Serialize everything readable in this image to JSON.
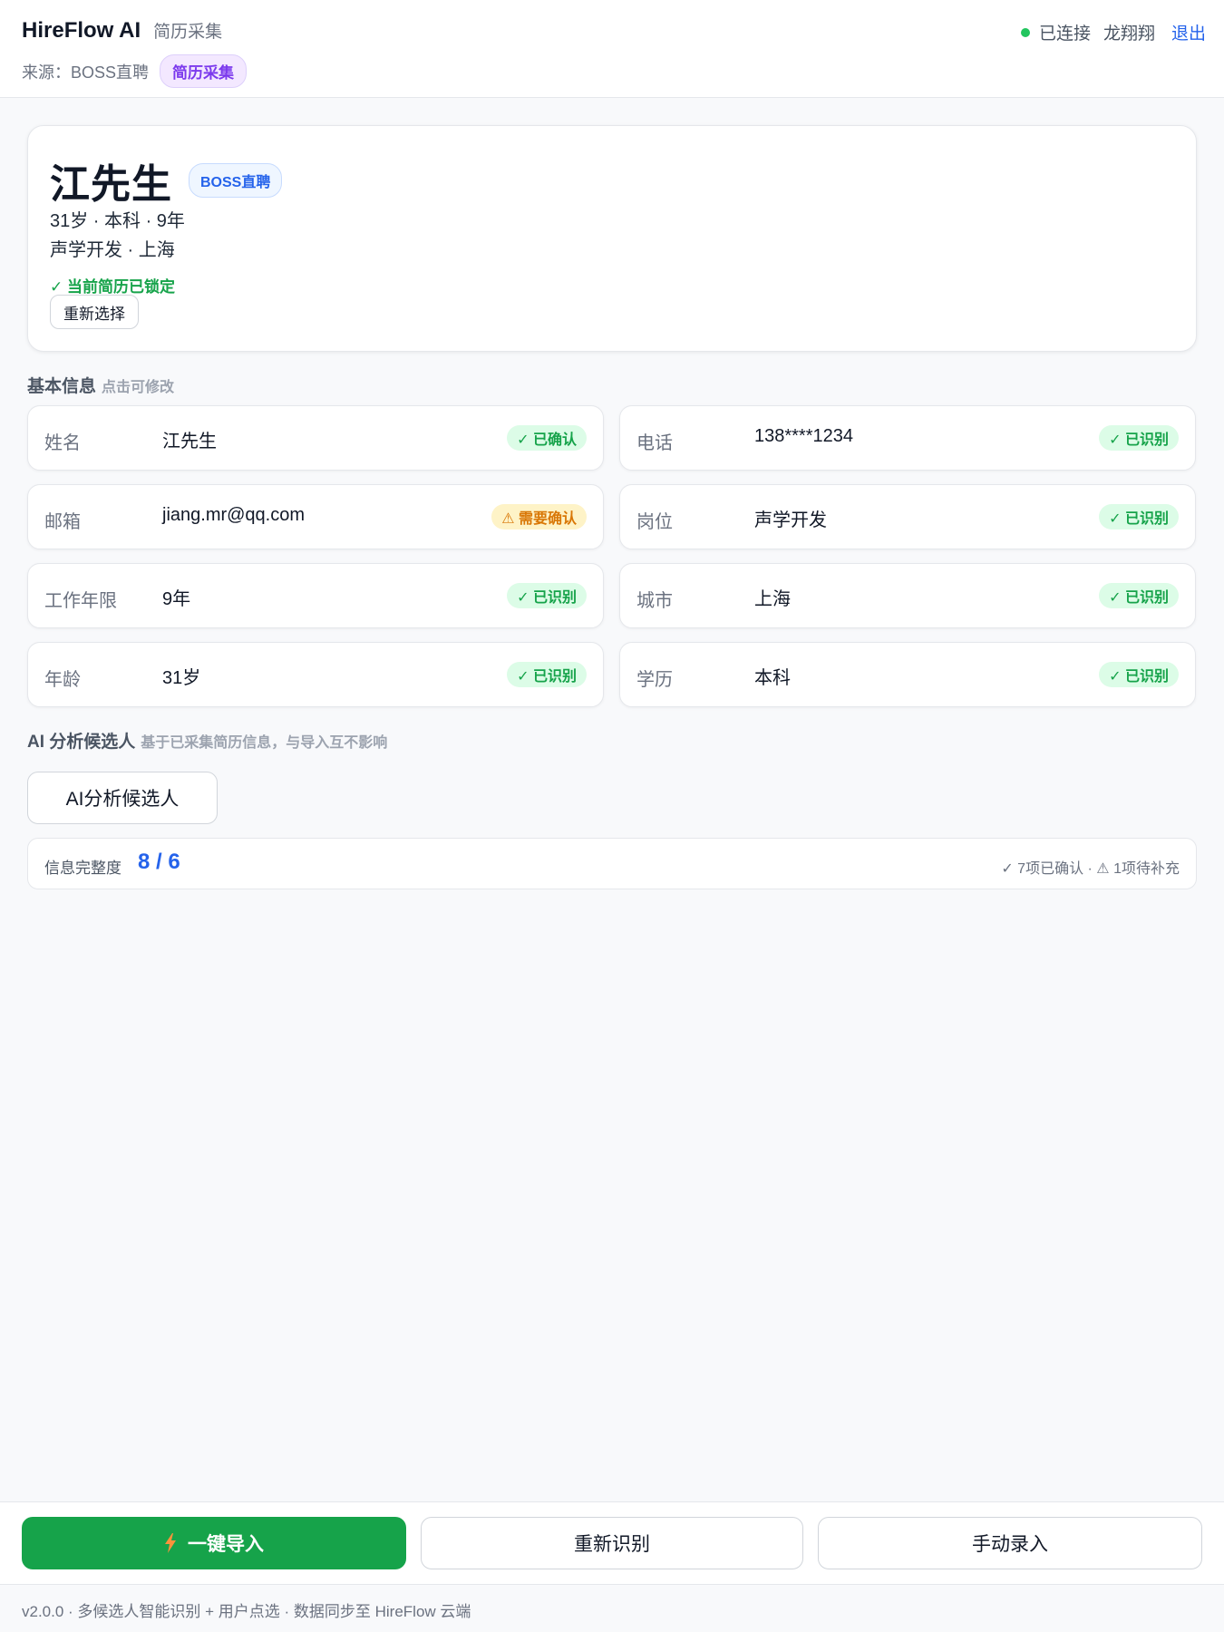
{
  "header": {
    "app_name": "HireFlow AI",
    "app_subtitle": "简历采集",
    "source_label": "来源：BOSS直聘",
    "mode_pill": "简历采集",
    "connection_status": "已连接",
    "user_name": "龙翔翔",
    "logout_label": "退出",
    "status_color": "#22c55e"
  },
  "profile": {
    "name": "江先生",
    "platform_badge": "BOSS直聘",
    "meta_line1": "31岁 · 本科 · 9年",
    "meta_line2": "声学开发 · 上海",
    "locked_text": "✓ 当前简历已锁定",
    "reselect_label": "重新选择"
  },
  "basic_info": {
    "title": "基本信息",
    "hint": "点击可修改",
    "fields": [
      {
        "label": "姓名",
        "value": "江先生",
        "tag": "✓ 已确认",
        "tag_type": "ok"
      },
      {
        "label": "电话",
        "value": "138****1234",
        "tag": "✓ 已识别",
        "tag_type": "ok"
      },
      {
        "label": "邮箱",
        "value": "jiang.mr@qq.com",
        "tag": "⚠ 需要确认",
        "tag_type": "warn"
      },
      {
        "label": "岗位",
        "value": "声学开发",
        "tag": "✓ 已识别",
        "tag_type": "ok"
      },
      {
        "label": "工作年限",
        "value": "9年",
        "tag": "✓ 已识别",
        "tag_type": "ok"
      },
      {
        "label": "城市",
        "value": "上海",
        "tag": "✓ 已识别",
        "tag_type": "ok"
      },
      {
        "label": "年龄",
        "value": "31岁",
        "tag": "✓ 已识别",
        "tag_type": "ok"
      },
      {
        "label": "学历",
        "value": "本科",
        "tag": "✓ 已识别",
        "tag_type": "ok"
      }
    ]
  },
  "ai_section": {
    "title": "AI 分析候选人",
    "hint": "基于已采集简历信息，与导入互不影响",
    "button_label": "AI分析候选人"
  },
  "completeness": {
    "label": "信息完整度",
    "value": "8 / 6",
    "summary": "✓ 7项已确认 · ⚠ 1项待补充"
  },
  "footer": {
    "import_label": "一键导入",
    "import_icon": "bolt-icon",
    "reidentify_label": "重新识别",
    "manual_label": "手动录入",
    "version_text": "v2.0.0 · 多候选人智能识别 + 用户点选 · 数据同步至 HireFlow 云端"
  },
  "colors": {
    "primary_green": "#16a34a",
    "accent_blue": "#2563eb",
    "purple": "#7c3aed",
    "warn_orange": "#d97706"
  }
}
